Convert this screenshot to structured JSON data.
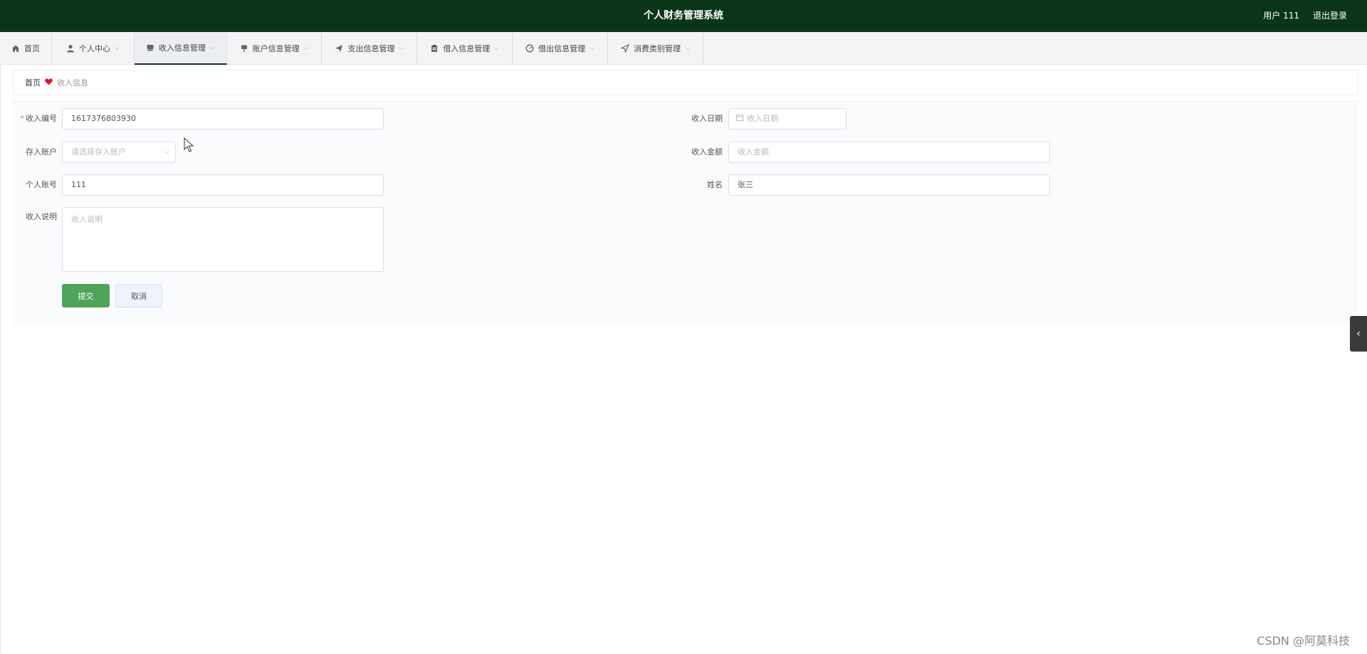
{
  "header": {
    "title": "个人财务管理系统",
    "user": "用户 111",
    "logout": "退出登录"
  },
  "nav": [
    {
      "label": "首页",
      "icon": "home-icon",
      "dropdown": false
    },
    {
      "label": "个人中心",
      "icon": "user-icon",
      "dropdown": true
    },
    {
      "label": "收入信息管理",
      "icon": "folder-icon",
      "dropdown": true,
      "active": true
    },
    {
      "label": "账户信息管理",
      "icon": "flag-icon",
      "dropdown": true
    },
    {
      "label": "支出信息管理",
      "icon": "send-icon",
      "dropdown": true
    },
    {
      "label": "借入信息管理",
      "icon": "clipboard-icon",
      "dropdown": true
    },
    {
      "label": "借出信息管理",
      "icon": "gauge-icon",
      "dropdown": true
    },
    {
      "label": "消费类别管理",
      "icon": "navigation-icon",
      "dropdown": true
    }
  ],
  "breadcrumb": {
    "home": "首页",
    "current": "收入信息"
  },
  "form": {
    "income_no": {
      "label": "收入编号",
      "value": "1617376803930",
      "required": true
    },
    "income_date": {
      "label": "收入日期",
      "placeholder": "收入日期"
    },
    "account": {
      "label": "存入账户",
      "placeholder": "请选择存入账户"
    },
    "amount": {
      "label": "收入金额",
      "placeholder": "收入金额"
    },
    "personal_account": {
      "label": "个人账号",
      "value": "111"
    },
    "name": {
      "label": "姓名",
      "value": "张三"
    },
    "description": {
      "label": "收入说明",
      "placeholder": "收入说明"
    },
    "submit": "提交",
    "cancel": "取消"
  },
  "watermark": "CSDN @阿莫科技",
  "colors": {
    "header_bg": "#0b3518",
    "primary": "#4fa457",
    "required": "#f56c6c",
    "heart": "#e0142c"
  }
}
